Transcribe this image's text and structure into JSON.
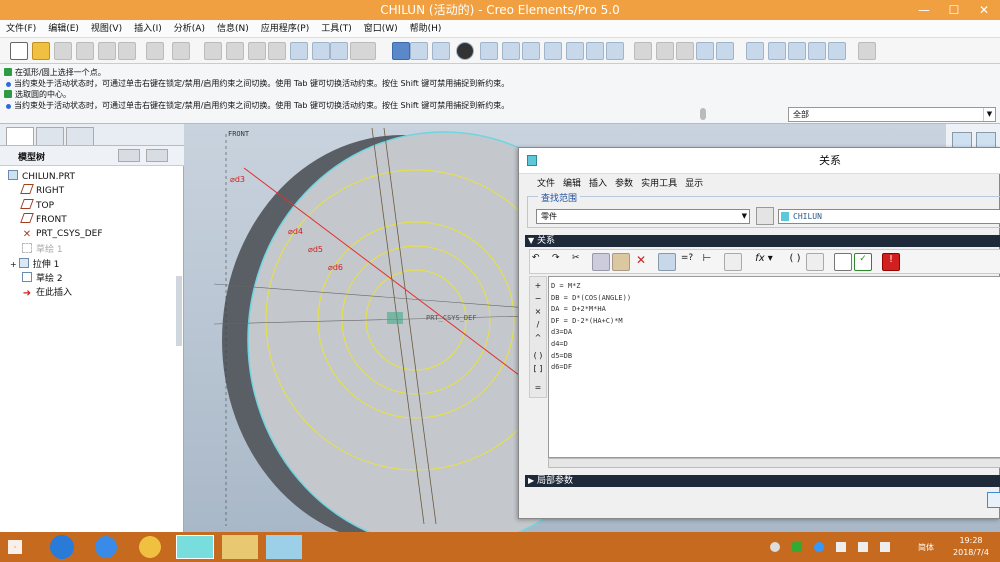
{
  "window": {
    "title": "CHILUN (活动的) - Creo Elements/Pro 5.0"
  },
  "menu": [
    "文件(F)",
    "编辑(E)",
    "视图(V)",
    "插入(I)",
    "分析(A)",
    "信息(N)",
    "应用程序(P)",
    "工具(T)",
    "窗口(W)",
    "帮助(H)"
  ],
  "messages": [
    {
      "icon": "green",
      "text": "在弧形/圆上选择一个点。"
    },
    {
      "icon": "blue",
      "text": "当约束处于活动状态时，可通过单击右键在锁定/禁用/启用约束之间切换。使用 Tab 键可切换活动约束。按住 Shift 键可禁用捕捉到新约束。"
    },
    {
      "icon": "green",
      "text": "选取圆的中心。"
    },
    {
      "icon": "blue",
      "text": "当约束处于活动状态时，可通过单击右键在锁定/禁用/启用约束之间切换。使用 Tab 键可切换活动约束。按住 Shift 键可禁用捕捉到新约束。"
    }
  ],
  "filter": {
    "value": "全部"
  },
  "tree": {
    "title": "模型树",
    "items": [
      {
        "label": "CHILUN.PRT",
        "icon": "part-icon"
      },
      {
        "label": "RIGHT",
        "icon": "datum-plane-icon"
      },
      {
        "label": "TOP",
        "icon": "datum-plane-icon"
      },
      {
        "label": "FRONT",
        "icon": "datum-plane-icon"
      },
      {
        "label": "PRT_CSYS_DEF",
        "icon": "csys-icon"
      },
      {
        "label": "草绘 1",
        "icon": "sketch-icon"
      },
      {
        "label": "拉伸 1",
        "icon": "extrude-icon"
      },
      {
        "label": "草绘 2",
        "icon": "sketch-icon"
      },
      {
        "label": "在此插入",
        "icon": "insert-arrow-icon"
      }
    ]
  },
  "graphics": {
    "front_label": "FRONT",
    "csys_label": "PRT_CSYS_DEF",
    "dims": [
      "⌀d3",
      "⌀d4",
      "⌀d5",
      "⌀d6"
    ]
  },
  "relations": {
    "title": "关系",
    "menu": [
      "文件",
      "编辑",
      "插入",
      "参数",
      "实用工具",
      "显示"
    ],
    "scope_label": "查找范围",
    "scope_type": "零件",
    "scope_name": "CHILUN",
    "section_label": "关系",
    "equations": [
      "D = M*Z",
      "DB = D*(COS(ANGLE))",
      "DA = D+2*M*HA",
      "DF = D-2*(HA+C)*M",
      "d3=DA",
      "d4=D",
      "d5=DB",
      "d6=DF"
    ],
    "operators": [
      "+",
      "−",
      "×",
      "/",
      "^",
      "( )",
      "[ ]",
      "="
    ],
    "local_params_label": "局部参数"
  },
  "taskbar": {
    "time": "19:28",
    "date": "2018/7/4",
    "ime": "简体"
  }
}
